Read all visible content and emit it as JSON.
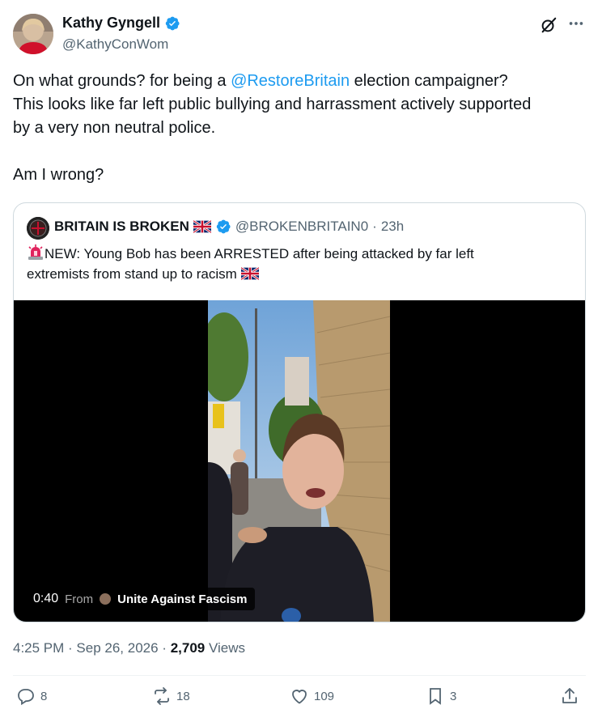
{
  "author": {
    "display_name": "Kathy Gyngell",
    "handle": "@KathyConWom"
  },
  "tweet": {
    "line1_before": "On what grounds?  for being a ",
    "mention": "@RestoreBritain",
    "line1_after": " election campaigner?",
    "line2": "This looks like far left public bullying and harrassment actively supported",
    "line3": "by a very non neutral police.",
    "line4": "Am I wrong?"
  },
  "quote": {
    "display_name": "BRITAIN IS BROKEN",
    "handle": "@BROKENBRITAIN0",
    "separator": "·",
    "time": "23h",
    "text_line1": "NEW: Young Bob has been ARRESTED after being attacked by far left",
    "text_line2": "extremists from stand up to racism",
    "video": {
      "duration": "0:40",
      "from_label": "From",
      "from_name": "Unite Against Fascism"
    }
  },
  "meta": {
    "time": "4:25 PM",
    "dot1": " · ",
    "date": "Sep 26, 2026",
    "dot2": " · ",
    "views": "2,709",
    "views_label": " Views"
  },
  "actions": {
    "replies": "8",
    "reposts": "18",
    "likes": "109",
    "bookmarks": "3"
  },
  "colors": {
    "accent": "#1d9bf0",
    "secondary_text": "#536471",
    "border": "#cfd9de"
  }
}
